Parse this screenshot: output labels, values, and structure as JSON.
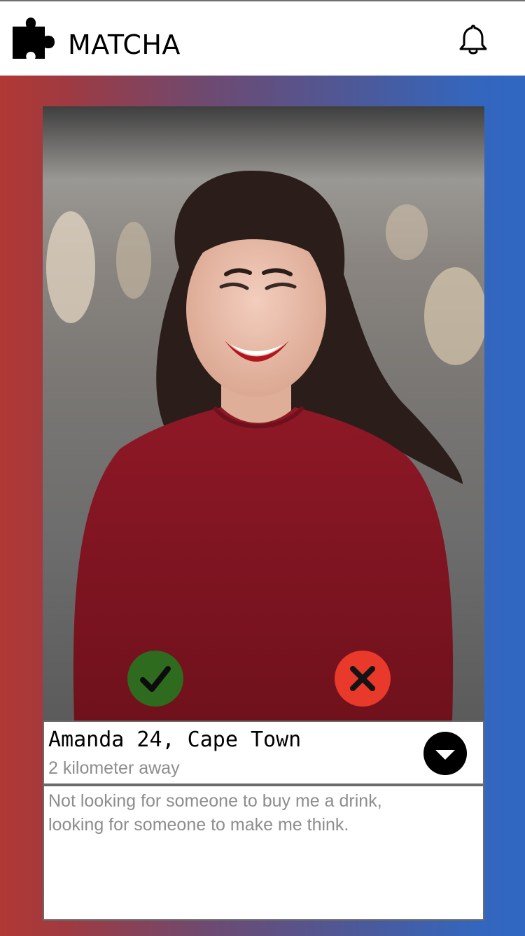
{
  "app": {
    "title": "MATCHA",
    "logo_icon": "puzzle-piece-icon",
    "notification_icon": "bell-icon"
  },
  "profile": {
    "name_line": "Amanda 24, Cape Town",
    "distance": "2 kilometer away",
    "bio": "Not looking for someone to buy me a drink, looking for someone to make me think.",
    "photo": "profile-photo"
  },
  "actions": {
    "like_icon": "checkmark-icon",
    "dislike_icon": "close-icon",
    "expand_icon": "chevron-down-icon"
  },
  "colors": {
    "like": "#2e6b1f",
    "dislike": "#e8392a",
    "gradient_left": "#b13834",
    "gradient_right": "#2f67c2"
  }
}
